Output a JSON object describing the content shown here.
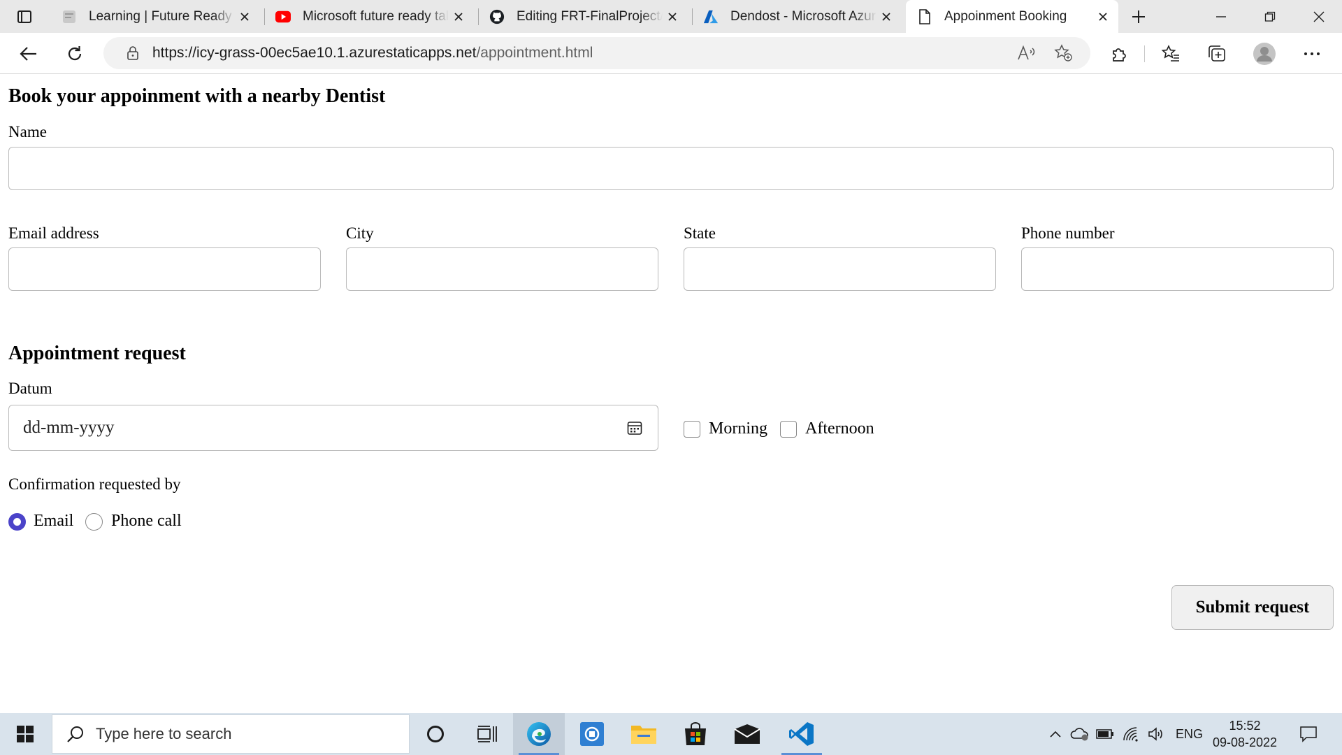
{
  "browser": {
    "tabs": [
      {
        "title": "Learning | Future Ready Ta",
        "icon": "learning-favicon"
      },
      {
        "title": "Microsoft future ready tale",
        "icon": "youtube-icon"
      },
      {
        "title": "Editing FRT-FinalProject/R",
        "icon": "github-icon"
      },
      {
        "title": "Dendost - Microsoft Azure",
        "icon": "azure-icon"
      },
      {
        "title": "Appoinment Booking",
        "icon": "document-icon",
        "active": true
      }
    ],
    "url_host": "https://icy-grass-00ec5ae10.1.azurestaticapps.net",
    "url_path": "/appointment.html"
  },
  "page": {
    "heading": "Book your appoinment with a nearby Dentist",
    "name_label": "Name",
    "email_label": "Email address",
    "city_label": "City",
    "state_label": "State",
    "phone_label": "Phone number",
    "request_heading": "Appointment request",
    "datum_label": "Datum",
    "date_placeholder": "dd-mm-yyyy",
    "morning_label": "Morning",
    "afternoon_label": "Afternoon",
    "confirmation_label": "Confirmation requested by",
    "email_option": "Email",
    "phone_option": "Phone call",
    "confirmation_selected": "Email",
    "morning_checked": false,
    "afternoon_checked": false,
    "submit_label": "Submit request"
  },
  "taskbar": {
    "search_placeholder": "Type here to search",
    "language": "ENG",
    "time": "15:52",
    "date": "09-08-2022"
  },
  "colors": {
    "radio_accent": "#4b43c9",
    "taskbar_bg": "#d9e3ec",
    "tabstrip_bg": "#e8e8e8"
  }
}
